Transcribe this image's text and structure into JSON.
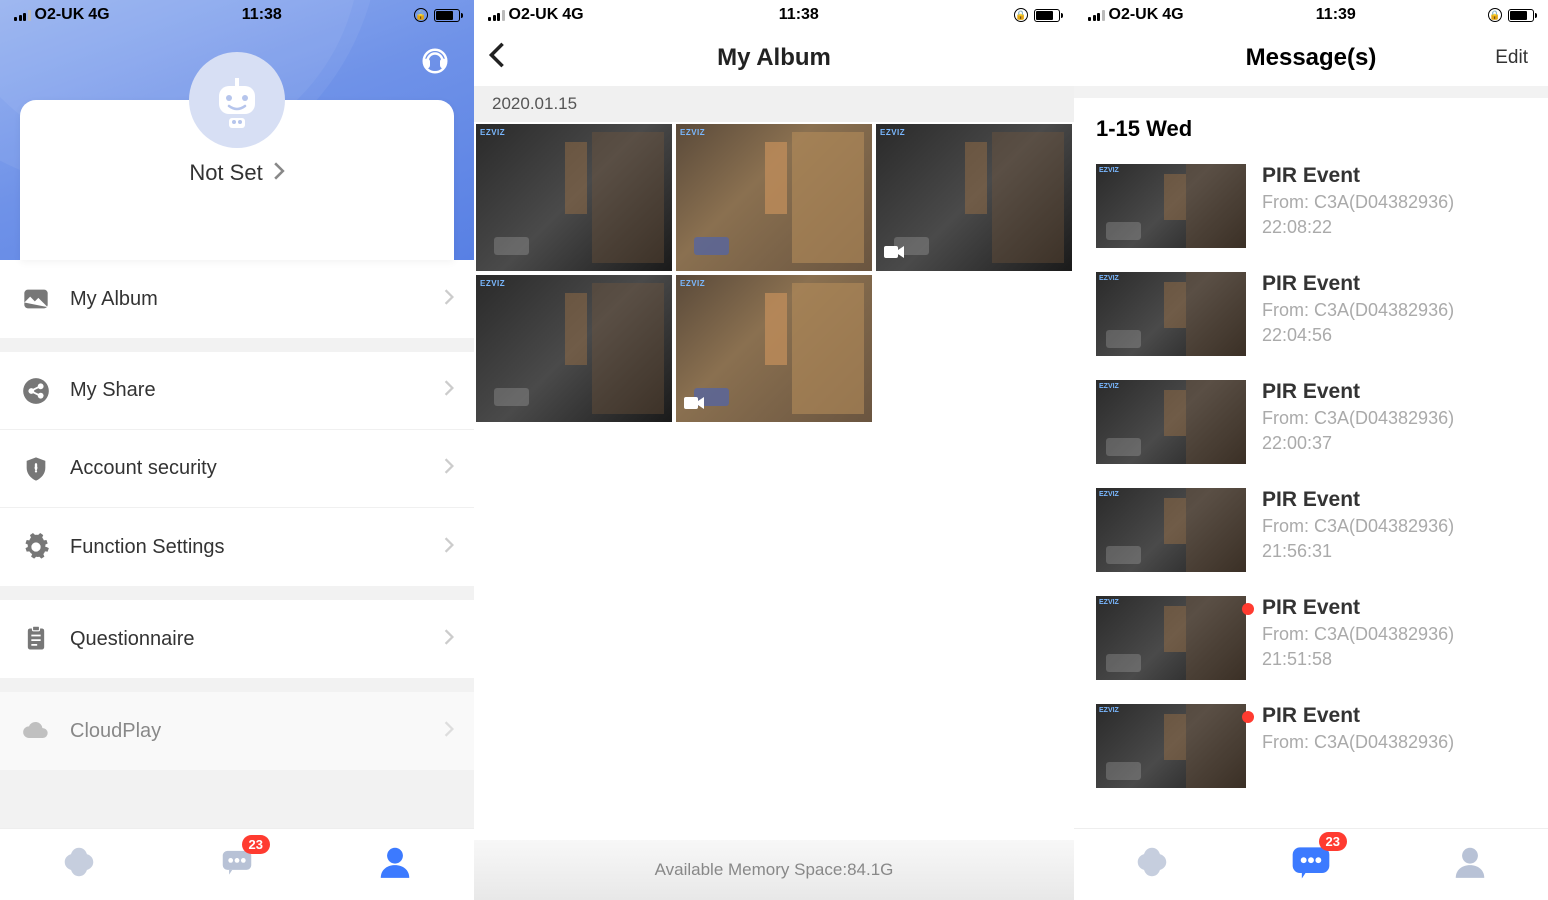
{
  "status": {
    "carrier": "O2-UK",
    "network": "4G"
  },
  "screen1": {
    "time": "11:38",
    "username": "Not Set",
    "menu_album": "My Album",
    "menu_share": "My Share",
    "menu_security": "Account security",
    "menu_function": "Function Settings",
    "menu_questionnaire": "Questionnaire",
    "menu_cloud": "CloudPlay",
    "badge_count": "23"
  },
  "screen2": {
    "time": "11:38",
    "title": "My Album",
    "date_header": "2020.01.15",
    "footer_label": "Available Memory Space:",
    "footer_value": "84.1G",
    "watermark": "EZVIZ",
    "thumbs": [
      {
        "mode": "night",
        "video": false
      },
      {
        "mode": "day",
        "video": false
      },
      {
        "mode": "night",
        "video": true
      },
      {
        "mode": "night",
        "video": false
      },
      {
        "mode": "day",
        "video": true
      }
    ]
  },
  "screen3": {
    "time": "11:39",
    "title": "Message(s)",
    "edit": "Edit",
    "date": "1-15 Wed",
    "badge_count": "23",
    "from_prefix": "From:",
    "device": "C3A(D04382936)",
    "events": [
      {
        "title": "PIR Event",
        "time": "22:08:22",
        "unread": false
      },
      {
        "title": "PIR Event",
        "time": "22:04:56",
        "unread": false
      },
      {
        "title": "PIR Event",
        "time": "22:00:37",
        "unread": false
      },
      {
        "title": "PIR Event",
        "time": "21:56:31",
        "unread": false
      },
      {
        "title": "PIR Event",
        "time": "21:51:58",
        "unread": true
      },
      {
        "title": "PIR Event",
        "time": "",
        "unread": true
      }
    ]
  }
}
